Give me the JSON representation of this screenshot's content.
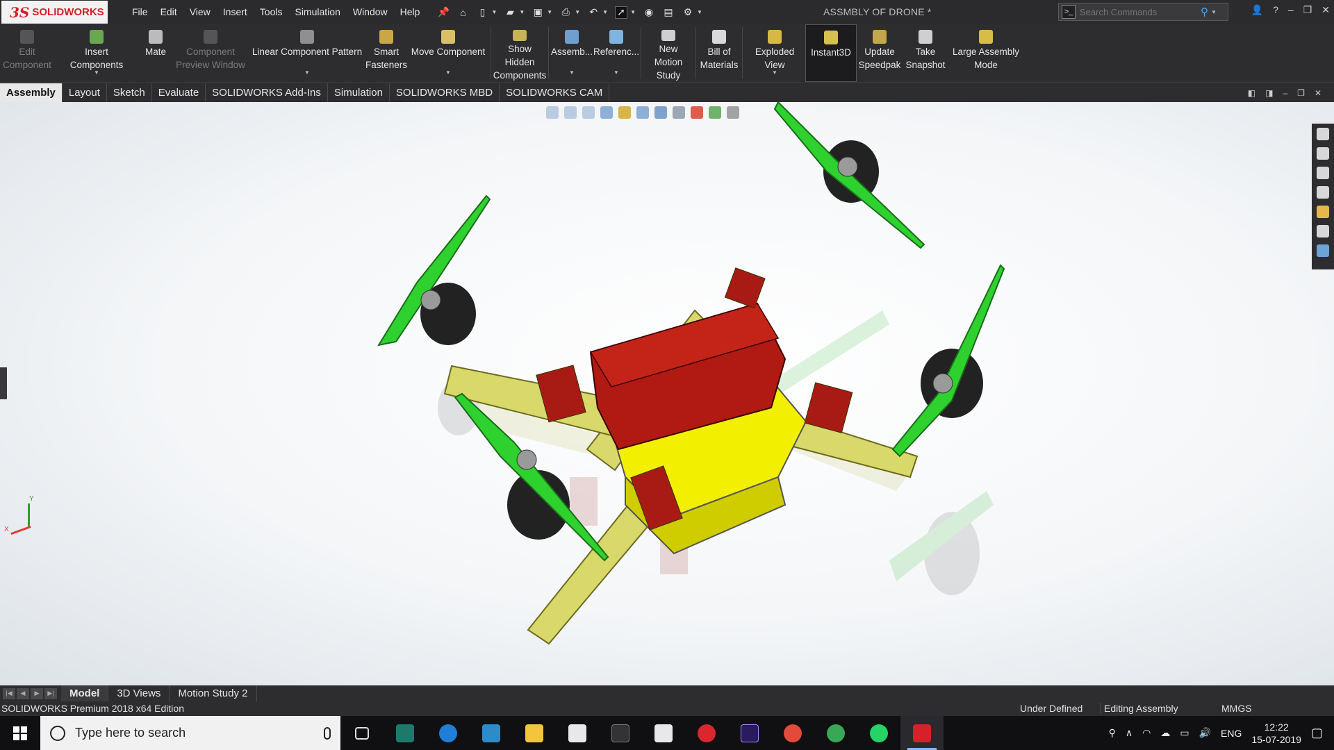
{
  "app": {
    "name": "SOLIDWORKS",
    "doc_title": "ASSMBLY OF DRONE *"
  },
  "menus": [
    "File",
    "Edit",
    "View",
    "Insert",
    "Tools",
    "Simulation",
    "Window",
    "Help"
  ],
  "search": {
    "placeholder": "Search Commands"
  },
  "commands": [
    {
      "label": "Edit Component",
      "disabled": true
    },
    {
      "label": "Insert Components",
      "disabled": false,
      "caret": true
    },
    {
      "label": "Mate",
      "disabled": false
    },
    {
      "label": "Component Preview Window",
      "disabled": true
    },
    {
      "label": "Linear Component Pattern",
      "disabled": false,
      "caret": true
    },
    {
      "label": "Smart Fasteners",
      "disabled": false
    },
    {
      "label": "Move Component",
      "disabled": false,
      "caret": true
    },
    {
      "label": "Show Hidden Components",
      "disabled": false
    },
    {
      "label": "Assemb...",
      "disabled": false,
      "caret": true
    },
    {
      "label": "Referenc...",
      "disabled": false,
      "caret": true
    },
    {
      "label": "New Motion Study",
      "disabled": false
    },
    {
      "label": "Bill of Materials",
      "disabled": false
    },
    {
      "label": "Exploded View",
      "disabled": false,
      "caret": true
    },
    {
      "label": "Instant3D",
      "disabled": false,
      "active": true
    },
    {
      "label": "Update Speedpak",
      "disabled": false
    },
    {
      "label": "Take Snapshot",
      "disabled": false
    },
    {
      "label": "Large Assembly Mode",
      "disabled": false
    }
  ],
  "tabs": [
    "Assembly",
    "Layout",
    "Sketch",
    "Evaluate",
    "SOLIDWORKS Add-Ins",
    "Simulation",
    "SOLIDWORKS MBD",
    "SOLIDWORKS CAM"
  ],
  "active_tab": "Assembly",
  "triad": {
    "x": "X",
    "y": "Y"
  },
  "bottom_tabs": [
    "Model",
    "3D Views",
    "Motion Study 2"
  ],
  "status": {
    "edition": "SOLIDWORKS Premium 2018 x64 Edition",
    "state": "Under Defined",
    "mode": "Editing Assembly",
    "units": "MMGS"
  },
  "taskbar": {
    "search_placeholder": "Type here to search",
    "lang": "ENG",
    "time": "12:22",
    "date": "15-07-2019"
  },
  "colors": {
    "accent": "#d6202a",
    "propeller": "#2ed12e",
    "frame": "#d9d86a",
    "battery": "#b01a12",
    "body": "#f2f000"
  }
}
